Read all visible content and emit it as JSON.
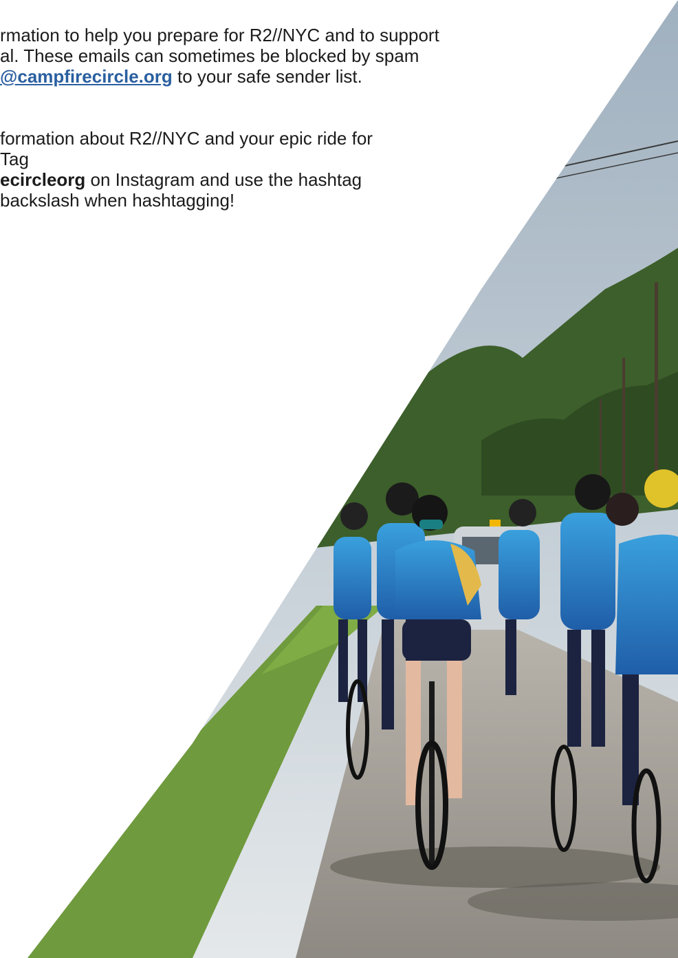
{
  "content": {
    "para1": {
      "line1": "rmation to help you prepare for R2//NYC and to support",
      "line2": "al. These emails can sometimes be blocked by spam",
      "line3_link": "@campfirecircle.org",
      "line3_rest": " to your safe sender list."
    },
    "para2": {
      "line1": "formation about R2//NYC and your epic ride for",
      "line2": "Tag",
      "line3_bold": "ecircleorg",
      "line3_rest": " on Instagram and use the hashtag",
      "line4": " backslash when hashtagging!"
    }
  },
  "photo": {
    "description_icon": "cyclists-photo",
    "colors": {
      "sky": "#c9d3dc",
      "trees": "#3c5b2a",
      "grass": "#6f9a3d",
      "road": "#a9a59c",
      "jersey": "#2f87c8",
      "jersey_yellow": "#e3b94b"
    }
  }
}
